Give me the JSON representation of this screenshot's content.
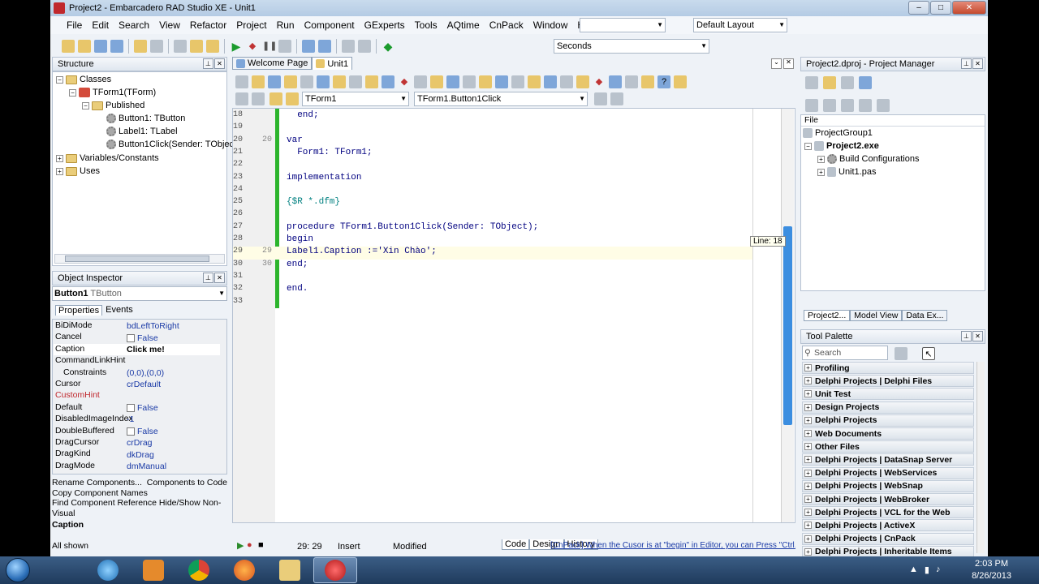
{
  "window": {
    "title": "Project2 - Embarcadero RAD Studio XE - Unit1",
    "controls": [
      "–",
      "□",
      "✕"
    ]
  },
  "menu": {
    "items": [
      "File",
      "Edit",
      "Search",
      "View",
      "Refactor",
      "Project",
      "Run",
      "Component",
      "GExperts",
      "Tools",
      "AQtime",
      "CnPack",
      "Window",
      "Help"
    ],
    "combo_blank": "",
    "layout": "Default Layout"
  },
  "toolbar": {
    "units_combo": "Seconds"
  },
  "structure": {
    "title": "Structure",
    "nodes": [
      "Classes",
      "TForm1(TForm)",
      "Published",
      "Button1: TButton",
      "Label1: TLabel",
      "Button1Click(Sender: TObject)",
      "Variables/Constants",
      "Uses"
    ]
  },
  "object_inspector": {
    "title": "Object Inspector",
    "selected_name": "Button1",
    "selected_type": "TButton",
    "tabs": [
      "Properties",
      "Events"
    ],
    "rows": [
      {
        "k": "BiDiMode",
        "v": "bdLeftToRight"
      },
      {
        "k": "Cancel",
        "v": "False",
        "chk": true
      },
      {
        "k": "Caption",
        "v": "Click me!",
        "sel": true
      },
      {
        "k": "CommandLinkHint",
        "v": ""
      },
      {
        "k": "Constraints",
        "v": "(0,0),(0,0)",
        "plus": true
      },
      {
        "k": "Cursor",
        "v": "crDefault"
      },
      {
        "k": "CustomHint",
        "v": "",
        "red": true
      },
      {
        "k": "Default",
        "v": "False",
        "chk": true
      },
      {
        "k": "DisabledImageIndex",
        "v": "-1"
      },
      {
        "k": "DoubleBuffered",
        "v": "False",
        "chk": true
      },
      {
        "k": "DragCursor",
        "v": "crDrag"
      },
      {
        "k": "DragKind",
        "v": "dkDrag"
      },
      {
        "k": "DragMode",
        "v": "dmManual"
      }
    ],
    "actions": [
      "Rename Components...",
      "Components to Code",
      "Copy Component Names",
      "Find Component Reference",
      "Hide/Show Non-Visual"
    ],
    "desc_title": "Caption",
    "status": "All shown"
  },
  "editor": {
    "tabs": [
      "Welcome Page",
      "Unit1"
    ],
    "class_combo": "TForm1",
    "method_combo": "TForm1.Button1Click",
    "lines": [
      {
        "n": "18",
        "n2": "",
        "t": "  end;"
      },
      {
        "n": "19",
        "n2": "",
        "t": ""
      },
      {
        "n": "20",
        "n2": "20",
        "t": "var"
      },
      {
        "n": "21",
        "n2": "",
        "t": "  Form1: TForm1;"
      },
      {
        "n": "22",
        "n2": "",
        "t": ""
      },
      {
        "n": "23",
        "n2": "",
        "t": "implementation"
      },
      {
        "n": "24",
        "n2": "",
        "t": ""
      },
      {
        "n": "25",
        "n2": "",
        "t": "{$R *.dfm}"
      },
      {
        "n": "26",
        "n2": "",
        "t": ""
      },
      {
        "n": "27",
        "n2": "",
        "t": "procedure TForm1.Button1Click(Sender: TObject);"
      },
      {
        "n": "28",
        "n2": "",
        "t": "begin"
      },
      {
        "n": "29",
        "n2": "29",
        "t": "Label1.Caption :='Xin Chào';"
      },
      {
        "n": "30",
        "n2": "30",
        "t": "end;"
      },
      {
        "n": "31",
        "n2": "",
        "t": ""
      },
      {
        "n": "32",
        "n2": "",
        "t": "end."
      },
      {
        "n": "33",
        "n2": "",
        "t": ""
      }
    ],
    "hint": "Line: 18",
    "status": {
      "position": "29: 29",
      "mode": "Insert",
      "state": "Modified"
    },
    "bottom_tabs": [
      "Code",
      "Design",
      "History"
    ],
    "cnpack_msg": "[CnPack] When the Cusor is at \"begin\" in Editor, you can Press \"Ctrl..."
  },
  "project_manager": {
    "title": "Project2.dproj - Project Manager",
    "col": "File",
    "nodes": [
      "ProjectGroup1",
      "Project2.exe",
      "Build Configurations",
      "Unit1.pas"
    ],
    "tabs": [
      "Project2...",
      "Model View",
      "Data Ex..."
    ]
  },
  "tool_palette": {
    "title": "Tool Palette",
    "search_placeholder": "Search",
    "items": [
      "Profiling",
      "Delphi Projects | Delphi Files",
      "Unit Test",
      "Design Projects",
      "Delphi Projects",
      "Web Documents",
      "Other Files",
      "Delphi Projects | DataSnap Server",
      "Delphi Projects | WebServices",
      "Delphi Projects | WebSnap",
      "Delphi Projects | WebBroker",
      "Delphi Projects | VCL for the Web",
      "Delphi Projects | ActiveX",
      "Delphi Projects | CnPack",
      "Delphi Projects | Inheritable Items"
    ]
  },
  "taskbar": {
    "time": "2:03 PM",
    "date": "8/26/2013"
  }
}
